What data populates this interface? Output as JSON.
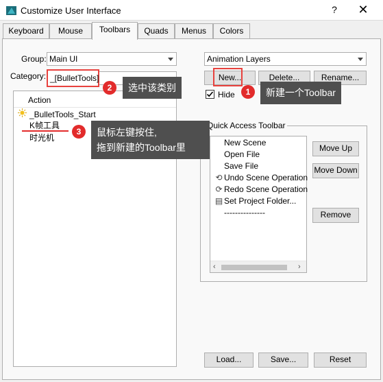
{
  "window": {
    "title": "Customize User Interface",
    "help_label": "?",
    "close_label": "✕"
  },
  "tabs": [
    {
      "label": "Keyboard"
    },
    {
      "label": "Mouse"
    },
    {
      "label": "Toolbars"
    },
    {
      "label": "Quads"
    },
    {
      "label": "Menus"
    },
    {
      "label": "Colors"
    }
  ],
  "active_tab": "Toolbars",
  "left": {
    "group_label": "Group:",
    "group_value": "Main UI",
    "category_label": "Category:",
    "category_value": "_[BulletTools]",
    "action_header": "Action",
    "actions": [
      "_BulletTools_Start",
      "K帧工具",
      "时光机"
    ]
  },
  "right": {
    "toolbar_value": "Animation Layers",
    "new_label": "New...",
    "delete_label": "Delete...",
    "rename_label": "Rename...",
    "hide_label": "Hide",
    "hide_checked": true,
    "qa_title": "Quick Access Toolbar",
    "qa_items": [
      {
        "label": "New Scene",
        "icon": ""
      },
      {
        "label": "Open File",
        "icon": ""
      },
      {
        "label": "Save File",
        "icon": ""
      },
      {
        "label": "Undo Scene Operation",
        "icon": "undo-icon"
      },
      {
        "label": "Redo Scene Operation",
        "icon": "redo-icon"
      },
      {
        "label": "Set Project Folder...",
        "icon": "folder-icon"
      },
      {
        "label": "---------------",
        "icon": ""
      }
    ],
    "move_up_label": "Move Up",
    "move_down_label": "Move Down",
    "remove_label": "Remove"
  },
  "footer": {
    "load_label": "Load...",
    "save_label": "Save...",
    "reset_label": "Reset"
  },
  "annotations": {
    "one": {
      "number": "1",
      "text": "新建一个Toolbar"
    },
    "two": {
      "number": "2",
      "text": "选中该类别"
    },
    "three": {
      "number": "3",
      "line1": "鼠标左键按住,",
      "line2": "拖到新建的Toolbar里"
    }
  },
  "colors": {
    "accent_red": "#e22b2b",
    "callout_bg": "#4f4f4f"
  }
}
